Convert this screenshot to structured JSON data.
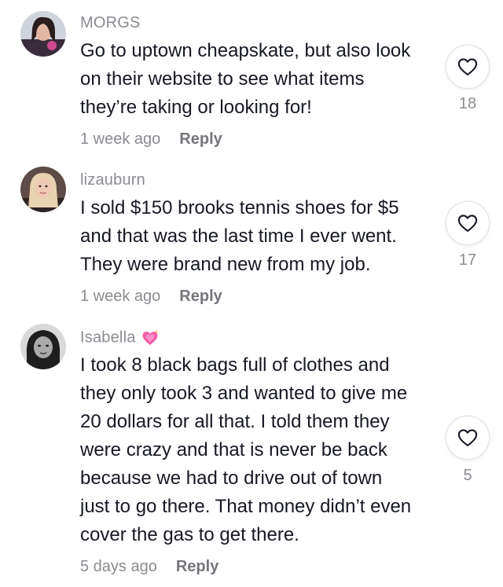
{
  "comments": [
    {
      "username": "MORGS",
      "text_lines": [
        "Go to uptown cheapskate, but also look",
        "on their website to see what items",
        "they’re taking or looking for!"
      ],
      "time": "1 week ago",
      "reply_label": "Reply",
      "likes": "18",
      "avatar_icon": "avatar-photo",
      "like_icon": "heart-outline-icon"
    },
    {
      "username": "lizauburn",
      "text_lines": [
        "I sold $150 brooks tennis shoes for $5",
        "and that was the last time I ever went.",
        "They were brand new from my job."
      ],
      "time": "1 week ago",
      "reply_label": "Reply",
      "likes": "17",
      "avatar_icon": "avatar-photo",
      "like_icon": "heart-outline-icon"
    },
    {
      "username": "Isabella",
      "username_emoji": "sparkling-heart-emoji",
      "text_lines": [
        "I took 8 black bags full of clothes and",
        "they only took 3 and wanted to give me",
        "20 dollars for all that. I told them they",
        "were crazy and that is never be back",
        "because we had to drive out of town",
        "just to go there. That money didn’t even",
        "cover the gas to get there."
      ],
      "time": "5 days ago",
      "reply_label": "Reply",
      "likes": "5",
      "avatar_icon": "avatar-photo",
      "like_icon": "heart-outline-icon"
    }
  ],
  "colors": {
    "text": "#161823",
    "secondary": "#8a8b91",
    "emoji_pink": "#f25fa8"
  }
}
